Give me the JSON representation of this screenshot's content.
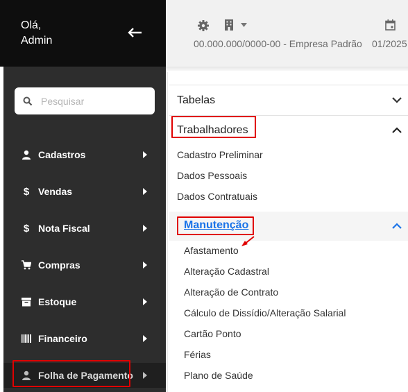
{
  "sidebar": {
    "greeting_line1": "Olá,",
    "greeting_line2": "Admin",
    "back_icon": "arrow-left-icon",
    "search_placeholder": "Pesquisar",
    "items": [
      {
        "label": "Cadastros",
        "icon": "user-icon"
      },
      {
        "label": "Vendas",
        "icon": "dollar-icon"
      },
      {
        "label": "Nota Fiscal",
        "icon": "dollar-icon"
      },
      {
        "label": "Compras",
        "icon": "cart-icon"
      },
      {
        "label": "Estoque",
        "icon": "archive-icon"
      },
      {
        "label": "Financeiro",
        "icon": "barcode-icon"
      },
      {
        "label": "Folha de Pagamento",
        "icon": "user-icon"
      }
    ]
  },
  "topbar": {
    "company": "00.000.000/0000-00 - Empresa Padrão",
    "period": "01/2025"
  },
  "panel": {
    "sections": [
      {
        "label": "Tabelas",
        "expanded": false
      },
      {
        "label": "Trabalhadores",
        "expanded": true
      }
    ],
    "trabalhadores_items": [
      "Cadastro Preliminar",
      "Dados Pessoais",
      "Dados Contratuais"
    ],
    "manutencao_label": "Manutenção",
    "manutencao_items": [
      "Afastamento",
      "Alteração Cadastral",
      "Alteração de Contrato",
      "Cálculo de Dissídio/Alteração Salarial",
      "Cartão Ponto",
      "Férias",
      "Plano de Saúde"
    ]
  },
  "colors": {
    "sidebar_bg": "#2d2d2d",
    "sidebar_top_bg": "#0e0e0e",
    "highlight_red": "#e00000",
    "link_blue": "#1a73e8"
  }
}
